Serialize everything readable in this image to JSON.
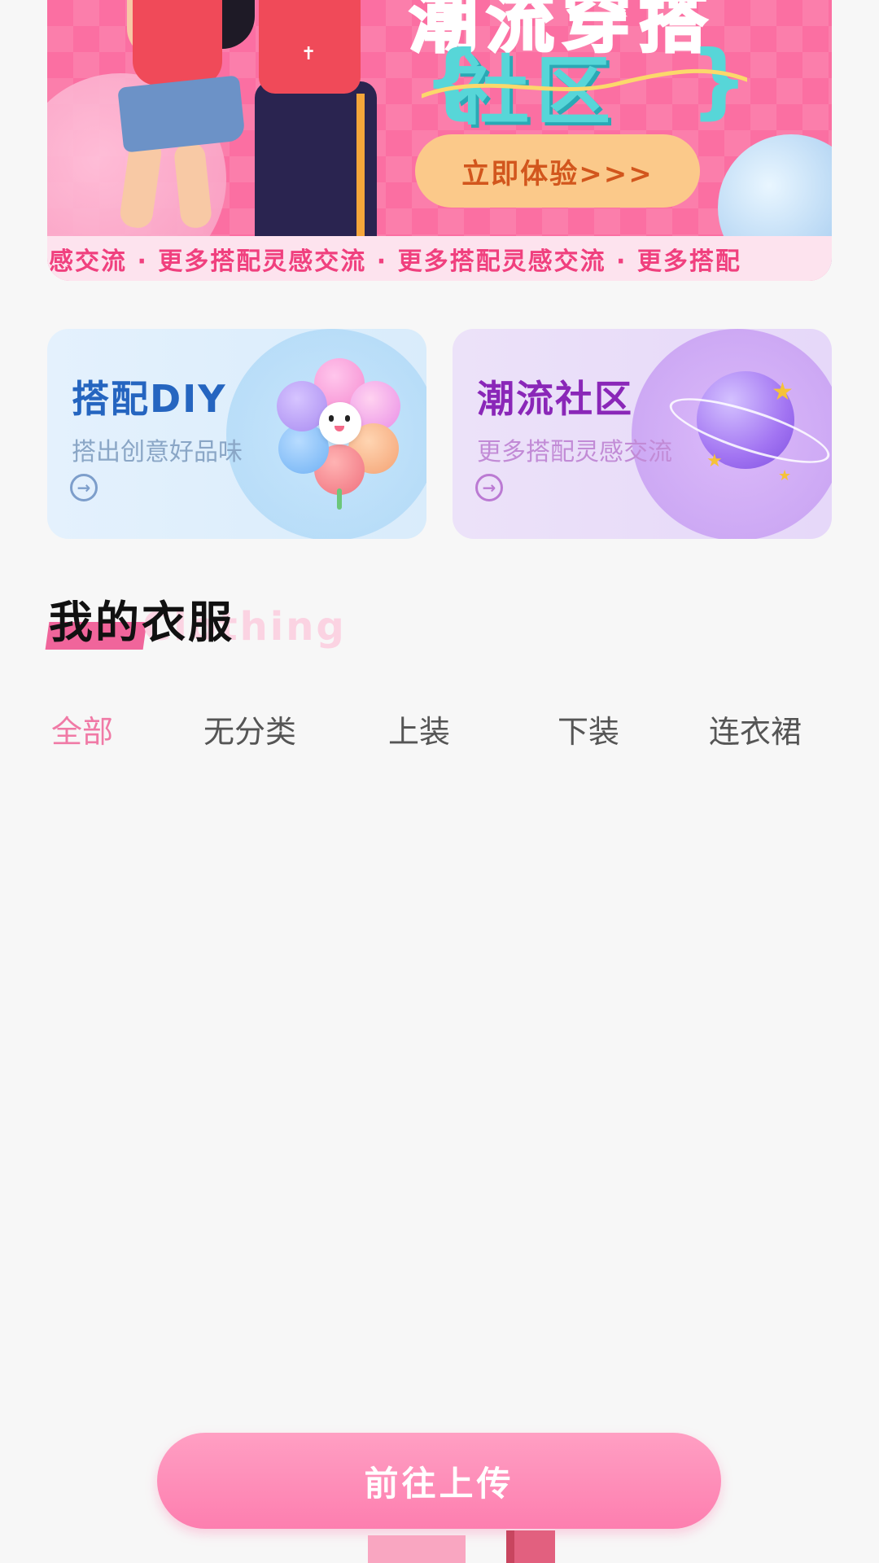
{
  "banner": {
    "title_line1": "潮流穿搭",
    "title_line2": "社区",
    "cta_label": "立即体验>>>",
    "ticker_text": "灵感交流 · 更多搭配灵感交流 · 更多搭配灵感交流 · 更多搭配"
  },
  "cards": [
    {
      "title": "搭配DIY",
      "subtitle": "搭出创意好品味",
      "arrow_icon": "arrow-circle-right-icon"
    },
    {
      "title": "潮流社区",
      "subtitle": "更多搭配灵感交流",
      "arrow_icon": "arrow-circle-right-icon"
    }
  ],
  "section": {
    "title": "我的衣服",
    "bg_word": "Clothing"
  },
  "tabs": [
    {
      "label": "全部",
      "active": true
    },
    {
      "label": "无分类",
      "active": false
    },
    {
      "label": "上装",
      "active": false
    },
    {
      "label": "下装",
      "active": false
    },
    {
      "label": "连衣裙",
      "active": false
    }
  ],
  "upload_button": {
    "label": "前往上传"
  },
  "colors": {
    "accent": "#fd7eaf",
    "active_tab": "#f07aa6",
    "diy_title": "#2565c0",
    "community_title": "#8a27b8"
  }
}
